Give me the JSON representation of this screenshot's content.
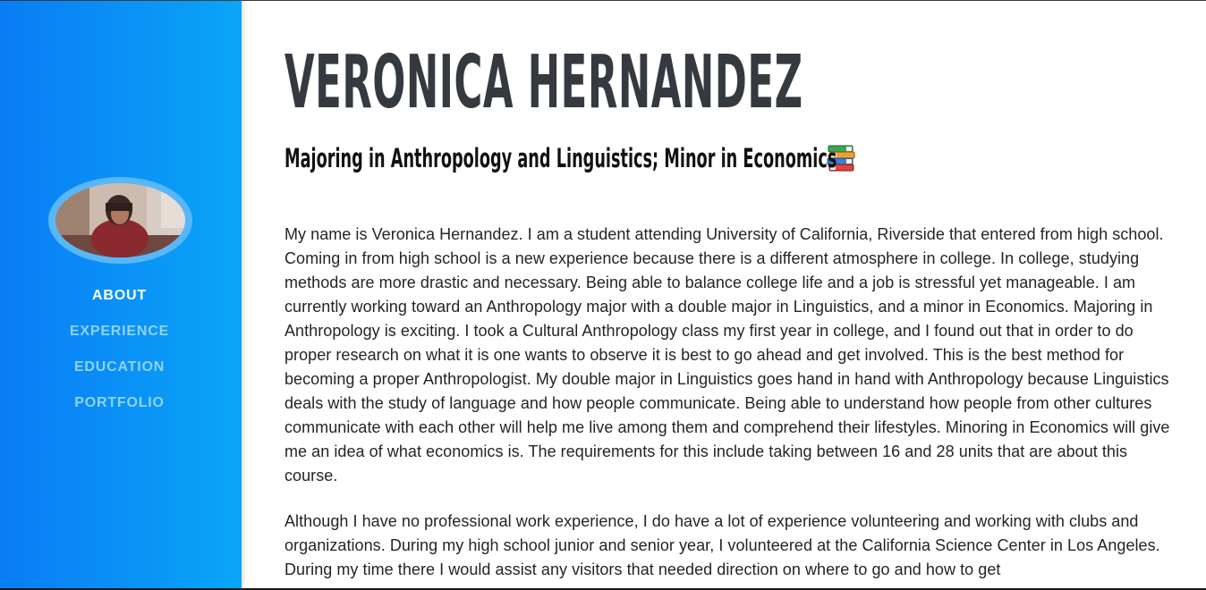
{
  "colors": {
    "sidebar_start": "#0a7cf5",
    "sidebar_end": "#0aa6f8",
    "nav_active": "#ffffff",
    "nav_inactive": "#8fd2fd",
    "heading": "#343a40",
    "body_text": "#212529"
  },
  "sidebar": {
    "avatar": "profile-photo",
    "nav": [
      {
        "label": "ABOUT",
        "active": true
      },
      {
        "label": "EXPERIENCE",
        "active": false
      },
      {
        "label": "EDUCATION",
        "active": false
      },
      {
        "label": "PORTFOLIO",
        "active": false
      }
    ]
  },
  "about": {
    "name": "VERONICA HERNANDEZ",
    "subheading": "Majoring in Anthropology and Linguistics; Minor in Economics",
    "subheading_icon": "books-icon",
    "paragraphs": [
      "My name is Veronica Hernandez. I am a student attending University of California, Riverside that entered from high school. Coming in from high school is a new experience because there is a different atmosphere in college. In college, studying methods are more drastic and necessary. Being able to balance college life and a job is stressful yet manageable. I am currently working toward an Anthropology major with a double major in Linguistics, and a minor in Economics. Majoring in Anthropology is exciting. I took a Cultural Anthropology class my first year in college, and I found out that in order to do proper research on what it is one wants to observe it is best to go ahead and get involved. This is the best method for becoming a proper Anthropologist. My double major in Linguistics goes hand in hand with Anthropology because Linguistics deals with the study of language and how people communicate. Being able to understand how people from other cultures communicate with each other will help me live among them and comprehend their lifestyles. Minoring in Economics will give me an idea of what economics is. The requirements for this include taking between 16 and 28 units that are about this course.",
      "Although I have no professional work experience, I do have a lot of experience volunteering and working with clubs and organizations. During my high school junior and senior year, I volunteered at the California Science Center in Los Angeles. During my time there I would assist any visitors that needed direction on where to go and how to get"
    ]
  }
}
